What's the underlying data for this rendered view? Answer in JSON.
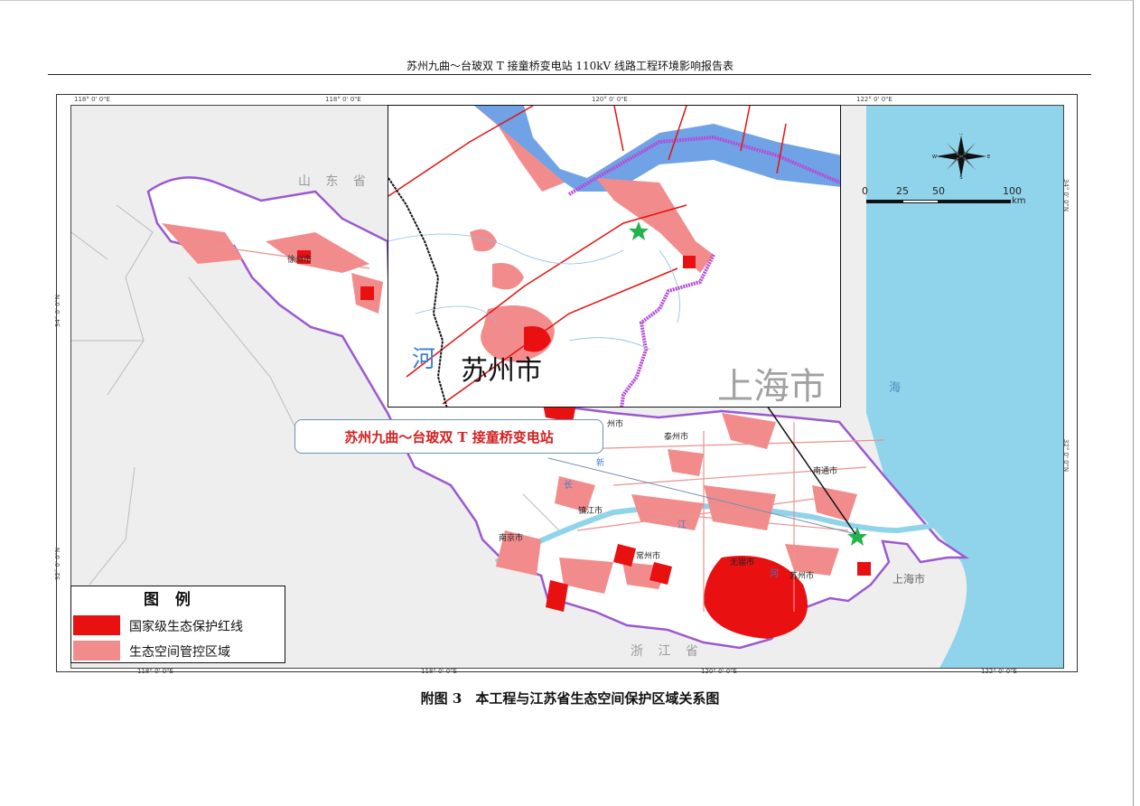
{
  "header": {
    "title": "苏州九曲～台玻双 T 接童桥变电站 110kV 线路工程环境影响报告表"
  },
  "map": {
    "provinces": {
      "shandong": "山 东 省",
      "zhejiang": "浙 江 省"
    },
    "cities": {
      "xuzhou": "徐州市",
      "taizhou": "泰州市",
      "nantong": "南通市",
      "zhenjiang": "镇江市",
      "nanjing": "南京市",
      "changzhou": "常州市",
      "wuxi": "无锡市",
      "suzhou": "苏州市",
      "yangzhou": "州市",
      "shanghai": "上海市"
    },
    "sea_label": "海",
    "river_labels": {
      "chang": "长",
      "jiang": "江",
      "xin": "新",
      "he": "河"
    },
    "ticks_top": [
      "118° 0' 0\"E",
      "118° 0' 0\"E",
      "120° 0' 0\"E",
      "122° 0' 0\"E"
    ],
    "ticks_bottom": [
      "118° 0' 0\"E",
      "118° 0' 0\"E",
      "120° 0' 0\"E",
      "122° 0' 0\"E"
    ],
    "ticks_left": [
      "34° 0' 0\"N",
      "32° 0' 0\"N"
    ],
    "ticks_right": [
      "34° 0' 0\"N",
      "32° 0' 0\"N"
    ]
  },
  "inset": {
    "city_label": "苏州市",
    "river_label": "河",
    "shanghai_label": "上海市"
  },
  "callout": {
    "text": "苏州九曲～台玻双 T 接童桥变电站"
  },
  "legend": {
    "title": "图 例",
    "items": [
      {
        "label": "国家级生态保护红线",
        "color": "#e81010"
      },
      {
        "label": "生态空间管控区域",
        "color": "#f28c8c"
      }
    ]
  },
  "scale": {
    "labels": [
      "0",
      "25",
      "50",
      "100"
    ],
    "unit": "km"
  },
  "compass": {
    "n": "N",
    "s": "S",
    "e": "E",
    "w": "W"
  },
  "caption": {
    "text": "附图 3　本工程与江苏省生态空间保护区域关系图"
  },
  "colors": {
    "red_line": "#e81010",
    "control_zone": "#f28c8c",
    "water": "#8fd4ea",
    "boundary": "#9b59d0",
    "land": "#eeeeee"
  }
}
